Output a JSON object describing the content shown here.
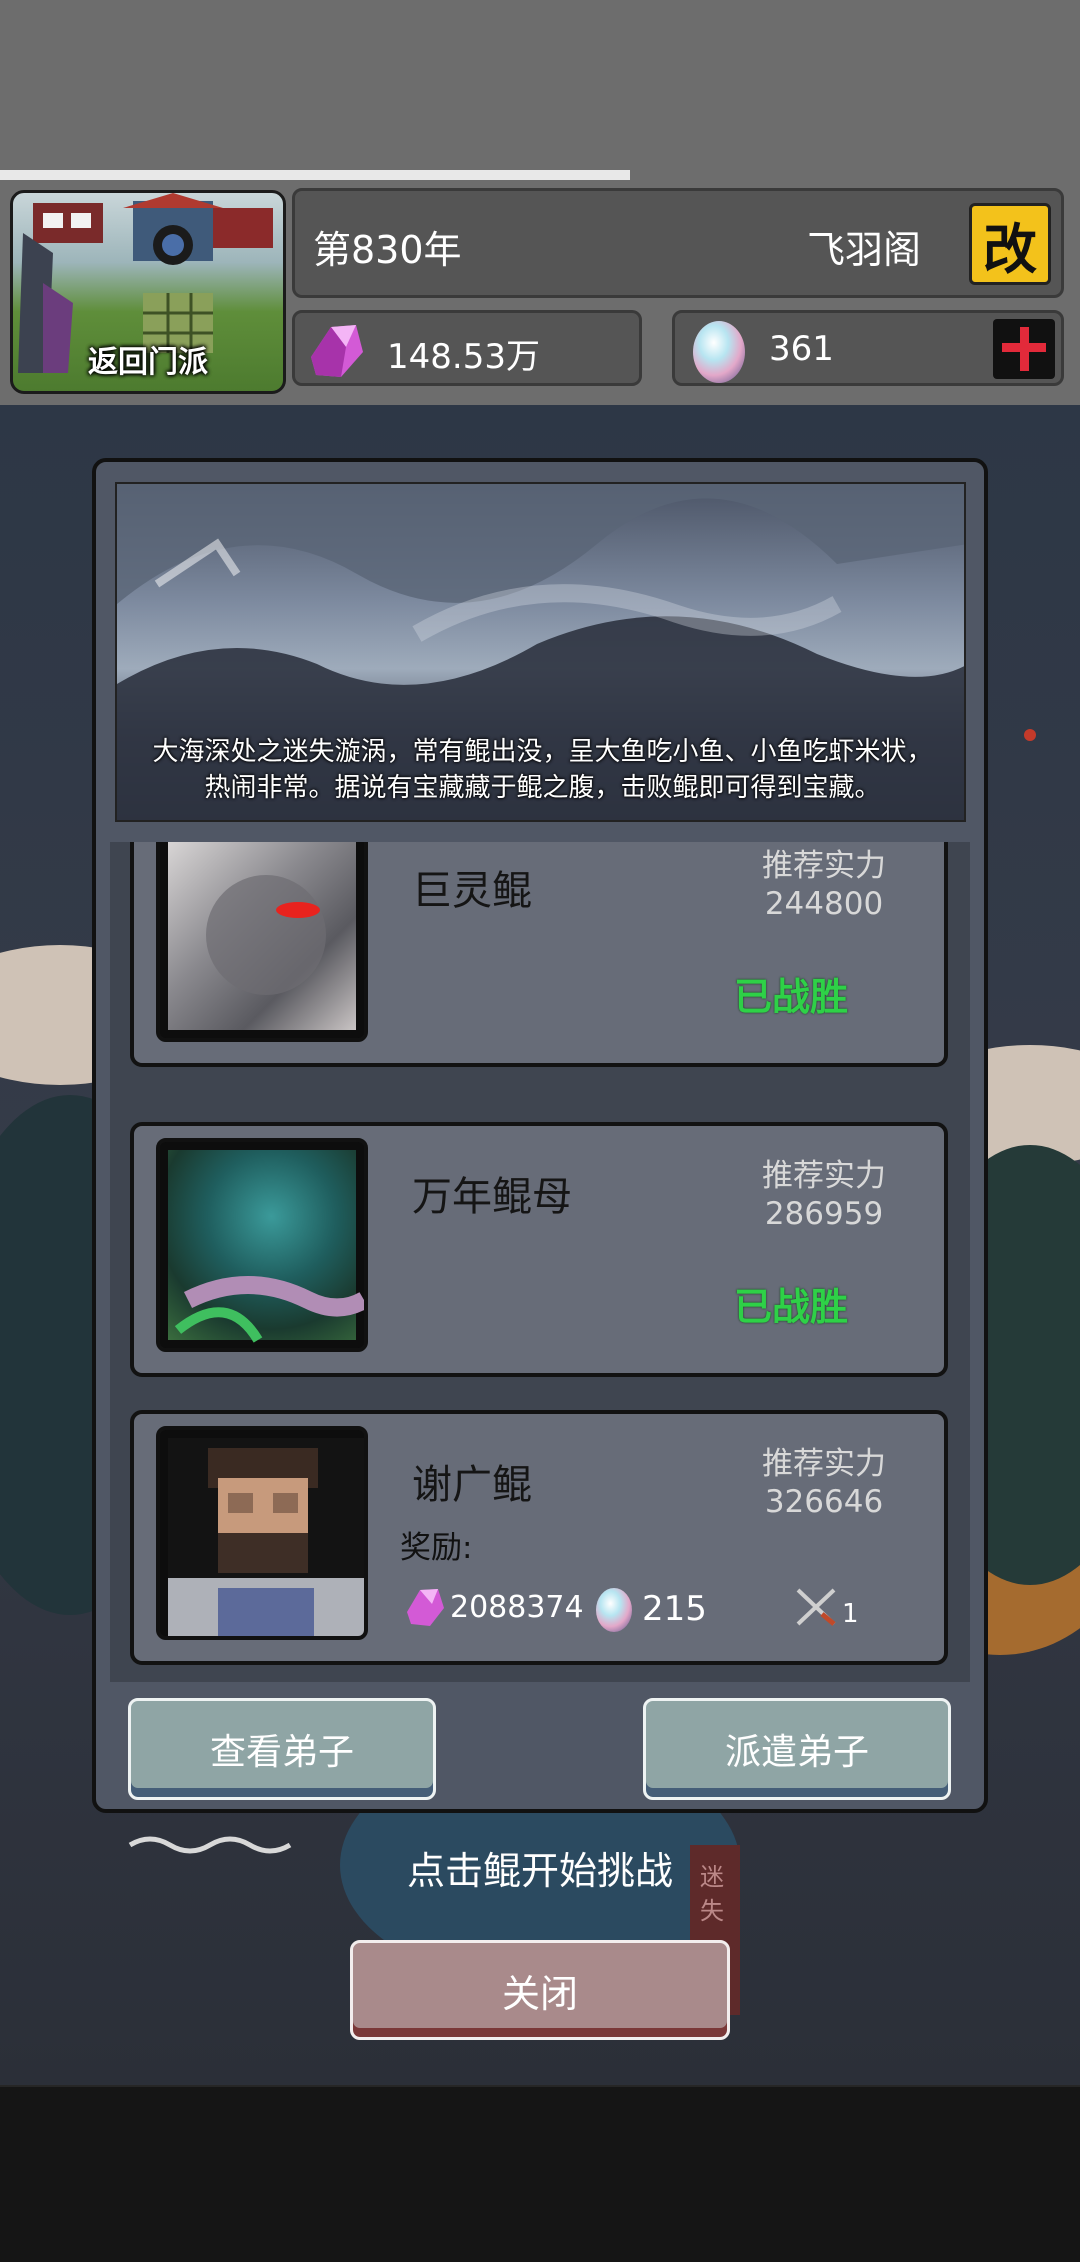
{
  "header": {
    "return_label": "返回门派",
    "year": "第830年",
    "sect_name": "飞羽阁",
    "rename_icon_text": "改",
    "spirit_stones": "148.53万",
    "eggs": "361",
    "add_icon": "plus-icon"
  },
  "banner": {
    "description_line1": "大海深处之迷失漩涡，常有鲲出没，呈大鱼吃小鱼、小鱼吃虾米状，",
    "description_line2": "热闹非常。据说有宝藏藏于鲲之腹，击败鲲即可得到宝藏。"
  },
  "bosses": [
    {
      "name": "巨灵鲲",
      "rec_label": "推荐实力",
      "rec_value": "244800",
      "status": "已战胜"
    },
    {
      "name": "万年鲲母",
      "rec_label": "推荐实力",
      "rec_value": "286959",
      "status": "已战胜"
    },
    {
      "name": "谢广鲲",
      "rec_label": "推荐实力",
      "rec_value": "326646",
      "reward_label": "奖励:",
      "reward_stones": "2088374",
      "reward_eggs": "215",
      "reward_item_count": "1"
    }
  ],
  "buttons": {
    "view_disciples": "查看弟子",
    "dispatch_disciples": "派遣弟子",
    "close": "关闭"
  },
  "hint": "点击鲲开始挑战",
  "background_sign": "迷失"
}
